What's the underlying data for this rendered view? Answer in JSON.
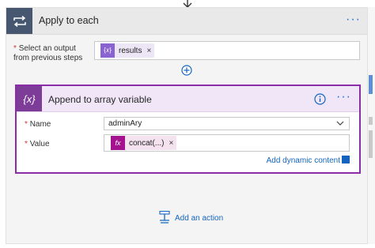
{
  "outer": {
    "title": "Apply to each",
    "output_label_line1": "Select an output",
    "output_label_line2": "from previous steps",
    "output_token": "results"
  },
  "inner": {
    "title": "Append to array variable",
    "name_label": "Name",
    "name_value": "adminAry",
    "value_label": "Value",
    "value_token": "concat(...)",
    "add_dynamic_content": "Add dynamic content"
  },
  "add_action": "Add an action",
  "glyphs": {
    "required": "*",
    "close": "×",
    "more": "···",
    "variable": "{x}",
    "fx": "fx"
  },
  "colors": {
    "loop_header": "#475770",
    "variable_accent": "#7d3c98",
    "expression_token": "#a4128f",
    "link_blue": "#1565c0"
  }
}
